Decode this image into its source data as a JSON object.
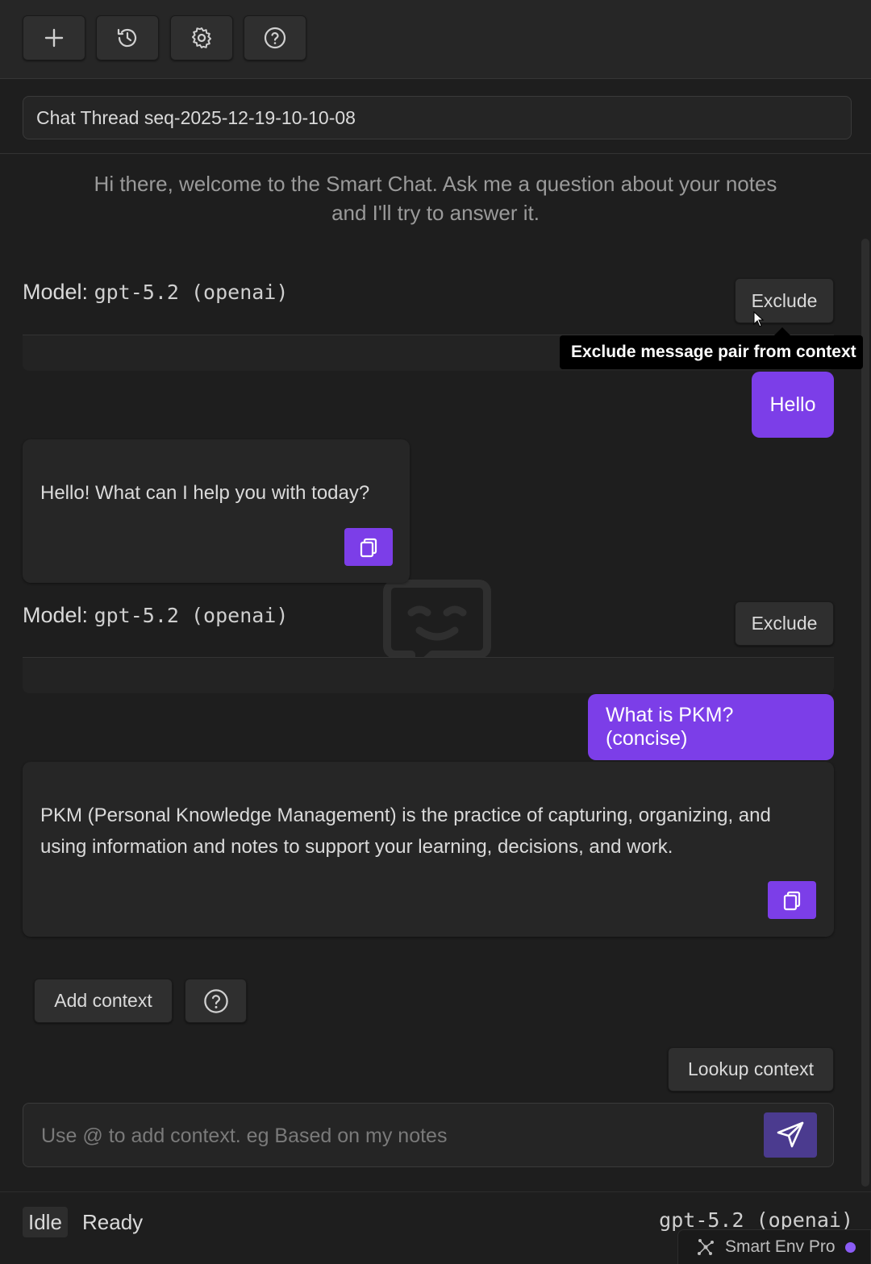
{
  "toolbar": {
    "buttons": [
      "new-chat-icon",
      "history-icon",
      "gear-icon",
      "help-icon"
    ]
  },
  "thread": {
    "title": "Chat Thread seq-2025-12-19-10-10-08"
  },
  "welcome": {
    "line1": "Hi there, welcome to the Smart Chat. Ask me a question about your notes",
    "line2": "and I'll try to answer it."
  },
  "messages": [
    {
      "model_label": "Model:",
      "model_name": "gpt-5.2",
      "model_provider": "(openai)",
      "exclude_label": "Exclude",
      "user_text": "Hello",
      "assistant_text": "Hello! What can I help you with today?"
    },
    {
      "model_label": "Model:",
      "model_name": "gpt-5.2",
      "model_provider": "(openai)",
      "exclude_label": "Exclude",
      "user_text": "What is PKM? (concise)",
      "assistant_line1": "PKM (Personal Knowledge Management) is the practice of capturing, organizing, and",
      "assistant_line2": "using information and notes to support your learning, decisions, and work."
    }
  ],
  "tooltip": {
    "text": "Exclude message pair from context"
  },
  "context": {
    "add_label": "Add context",
    "lookup_label": "Lookup context"
  },
  "input": {
    "placeholder": "Use @ to add context. eg Based on my notes"
  },
  "status": {
    "state": "Idle",
    "message": "Ready",
    "model": "gpt-5.2 (openai)"
  },
  "env": {
    "label": "Smart Env Pro"
  },
  "colors": {
    "accent": "#7c3ee8",
    "send_button": "#4b3b8f",
    "status_dot": "#8b5cf6",
    "background": "#1e1e1e"
  }
}
